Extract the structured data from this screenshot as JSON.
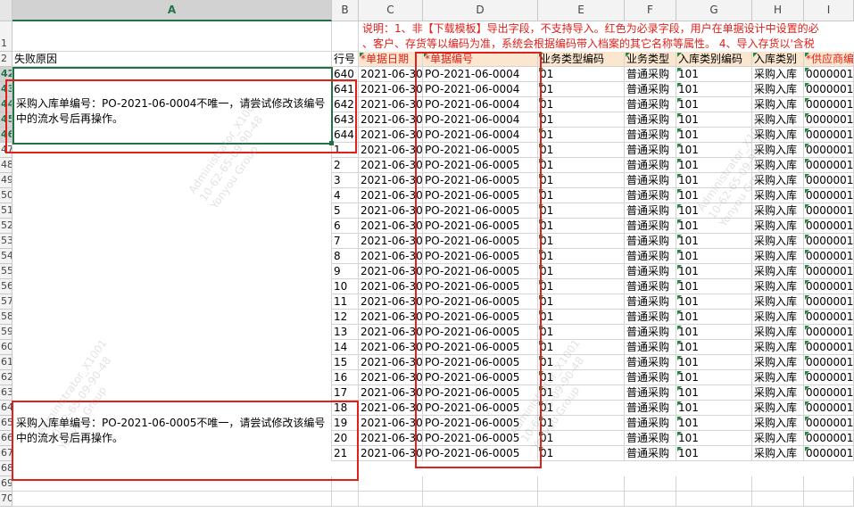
{
  "columns": [
    "A",
    "B",
    "C",
    "D",
    "E",
    "F",
    "G",
    "H",
    "I"
  ],
  "selected_column": "A",
  "note_line1": "说明：1、非【下载模板】导出字段，不支持导入。红色为必录字段，用户在单据设计中设置的必",
  "note_line2": "、客户、存货等以编码为准，系统会根据编码带入档案的其它名称等属性。 4、导入存货以'含税",
  "header": {
    "fail_reason": "失败原因",
    "row_no": "行号",
    "doc_date": "*单据日期",
    "doc_no": "*单据编号",
    "biz_type_code": "业务类型编码",
    "biz_type": "业务类型",
    "in_cat_code": "入库类别编码",
    "in_cat": "入库类别",
    "supplier_code": "*供应商编"
  },
  "row_numbers": [
    "1",
    "2",
    "42",
    "43",
    "44",
    "45",
    "46",
    "47",
    "48",
    "49",
    "50",
    "51",
    "52",
    "53",
    "54",
    "55",
    "56",
    "57",
    "58",
    "59",
    "60",
    "61",
    "62",
    "63",
    "64",
    "65",
    "66",
    "67",
    "68",
    "69",
    "70"
  ],
  "selected_rows": [
    "42",
    "43",
    "44",
    "45",
    "46"
  ],
  "rows": [
    {
      "line": "640",
      "date": "2021-06-30",
      "doc": "PO-2021-06-0004",
      "code": "01",
      "type": "普通采购",
      "cat_code": "101",
      "cat": "采购入库",
      "supplier": "0000001"
    },
    {
      "line": "641",
      "date": "2021-06-30",
      "doc": "PO-2021-06-0004",
      "code": "01",
      "type": "普通采购",
      "cat_code": "101",
      "cat": "采购入库",
      "supplier": "0000001"
    },
    {
      "line": "642",
      "date": "2021-06-30",
      "doc": "PO-2021-06-0004",
      "code": "01",
      "type": "普通采购",
      "cat_code": "101",
      "cat": "采购入库",
      "supplier": "0000001"
    },
    {
      "line": "643",
      "date": "2021-06-30",
      "doc": "PO-2021-06-0004",
      "code": "01",
      "type": "普通采购",
      "cat_code": "101",
      "cat": "采购入库",
      "supplier": "0000001"
    },
    {
      "line": "644",
      "date": "2021-06-30",
      "doc": "PO-2021-06-0004",
      "code": "01",
      "type": "普通采购",
      "cat_code": "101",
      "cat": "采购入库",
      "supplier": "0000001"
    },
    {
      "line": "1",
      "date": "2021-06-30",
      "doc": "PO-2021-06-0005",
      "code": "01",
      "type": "普通采购",
      "cat_code": "101",
      "cat": "采购入库",
      "supplier": "0000001"
    },
    {
      "line": "2",
      "date": "2021-06-30",
      "doc": "PO-2021-06-0005",
      "code": "01",
      "type": "普通采购",
      "cat_code": "101",
      "cat": "采购入库",
      "supplier": "0000001"
    },
    {
      "line": "3",
      "date": "2021-06-30",
      "doc": "PO-2021-06-0005",
      "code": "01",
      "type": "普通采购",
      "cat_code": "101",
      "cat": "采购入库",
      "supplier": "0000001"
    },
    {
      "line": "4",
      "date": "2021-06-30",
      "doc": "PO-2021-06-0005",
      "code": "01",
      "type": "普通采购",
      "cat_code": "101",
      "cat": "采购入库",
      "supplier": "0000001"
    },
    {
      "line": "5",
      "date": "2021-06-30",
      "doc": "PO-2021-06-0005",
      "code": "01",
      "type": "普通采购",
      "cat_code": "101",
      "cat": "采购入库",
      "supplier": "0000001"
    },
    {
      "line": "6",
      "date": "2021-06-30",
      "doc": "PO-2021-06-0005",
      "code": "01",
      "type": "普通采购",
      "cat_code": "101",
      "cat": "采购入库",
      "supplier": "0000001"
    },
    {
      "line": "7",
      "date": "2021-06-30",
      "doc": "PO-2021-06-0005",
      "code": "01",
      "type": "普通采购",
      "cat_code": "101",
      "cat": "采购入库",
      "supplier": "0000001"
    },
    {
      "line": "8",
      "date": "2021-06-30",
      "doc": "PO-2021-06-0005",
      "code": "01",
      "type": "普通采购",
      "cat_code": "101",
      "cat": "采购入库",
      "supplier": "0000001"
    },
    {
      "line": "9",
      "date": "2021-06-30",
      "doc": "PO-2021-06-0005",
      "code": "01",
      "type": "普通采购",
      "cat_code": "101",
      "cat": "采购入库",
      "supplier": "0000001"
    },
    {
      "line": "10",
      "date": "2021-06-30",
      "doc": "PO-2021-06-0005",
      "code": "01",
      "type": "普通采购",
      "cat_code": "101",
      "cat": "采购入库",
      "supplier": "0000001"
    },
    {
      "line": "11",
      "date": "2021-06-30",
      "doc": "PO-2021-06-0005",
      "code": "01",
      "type": "普通采购",
      "cat_code": "101",
      "cat": "采购入库",
      "supplier": "0000001"
    },
    {
      "line": "12",
      "date": "2021-06-30",
      "doc": "PO-2021-06-0005",
      "code": "01",
      "type": "普通采购",
      "cat_code": "101",
      "cat": "采购入库",
      "supplier": "0000001"
    },
    {
      "line": "13",
      "date": "2021-06-30",
      "doc": "PO-2021-06-0005",
      "code": "01",
      "type": "普通采购",
      "cat_code": "101",
      "cat": "采购入库",
      "supplier": "0000001"
    },
    {
      "line": "14",
      "date": "2021-06-30",
      "doc": "PO-2021-06-0005",
      "code": "01",
      "type": "普通采购",
      "cat_code": "101",
      "cat": "采购入库",
      "supplier": "0000001"
    },
    {
      "line": "15",
      "date": "2021-06-30",
      "doc": "PO-2021-06-0005",
      "code": "01",
      "type": "普通采购",
      "cat_code": "101",
      "cat": "采购入库",
      "supplier": "0000001"
    },
    {
      "line": "16",
      "date": "2021-06-30",
      "doc": "PO-2021-06-0005",
      "code": "01",
      "type": "普通采购",
      "cat_code": "101",
      "cat": "采购入库",
      "supplier": "0000001"
    },
    {
      "line": "17",
      "date": "2021-06-30",
      "doc": "PO-2021-06-0005",
      "code": "01",
      "type": "普通采购",
      "cat_code": "101",
      "cat": "采购入库",
      "supplier": "0000001"
    },
    {
      "line": "18",
      "date": "2021-06-30",
      "doc": "PO-2021-06-0005",
      "code": "01",
      "type": "普通采购",
      "cat_code": "101",
      "cat": "采购入库",
      "supplier": "0000001"
    },
    {
      "line": "19",
      "date": "2021-06-30",
      "doc": "PO-2021-06-0005",
      "code": "01",
      "type": "普通采购",
      "cat_code": "101",
      "cat": "采购入库",
      "supplier": "0000001"
    },
    {
      "line": "20",
      "date": "2021-06-30",
      "doc": "PO-2021-06-0005",
      "code": "01",
      "type": "普通采购",
      "cat_code": "101",
      "cat": "采购入库",
      "supplier": "0000001"
    },
    {
      "line": "21",
      "date": "2021-06-30",
      "doc": "PO-2021-06-0005",
      "code": "01",
      "type": "普通采购",
      "cat_code": "101",
      "cat": "采购入库",
      "supplier": "0000001"
    }
  ],
  "fail_messages": [
    "采购入库单编号：PO-2021-06-0004不唯一，请尝试修改该编号中的流水号后再操作。",
    "采购入库单编号：PO-2021-06-0005不唯一，请尝试修改该编号中的流水号后再操作。"
  ],
  "watermark": [
    "Administrator_X1001",
    "10-62-65-09-90-48",
    "Yonyou Group"
  ],
  "colors": {
    "accent": "#217346",
    "error": "#e0201a",
    "header_fill": "#fbe7cf",
    "comment_marker": "#1f8a3b"
  }
}
